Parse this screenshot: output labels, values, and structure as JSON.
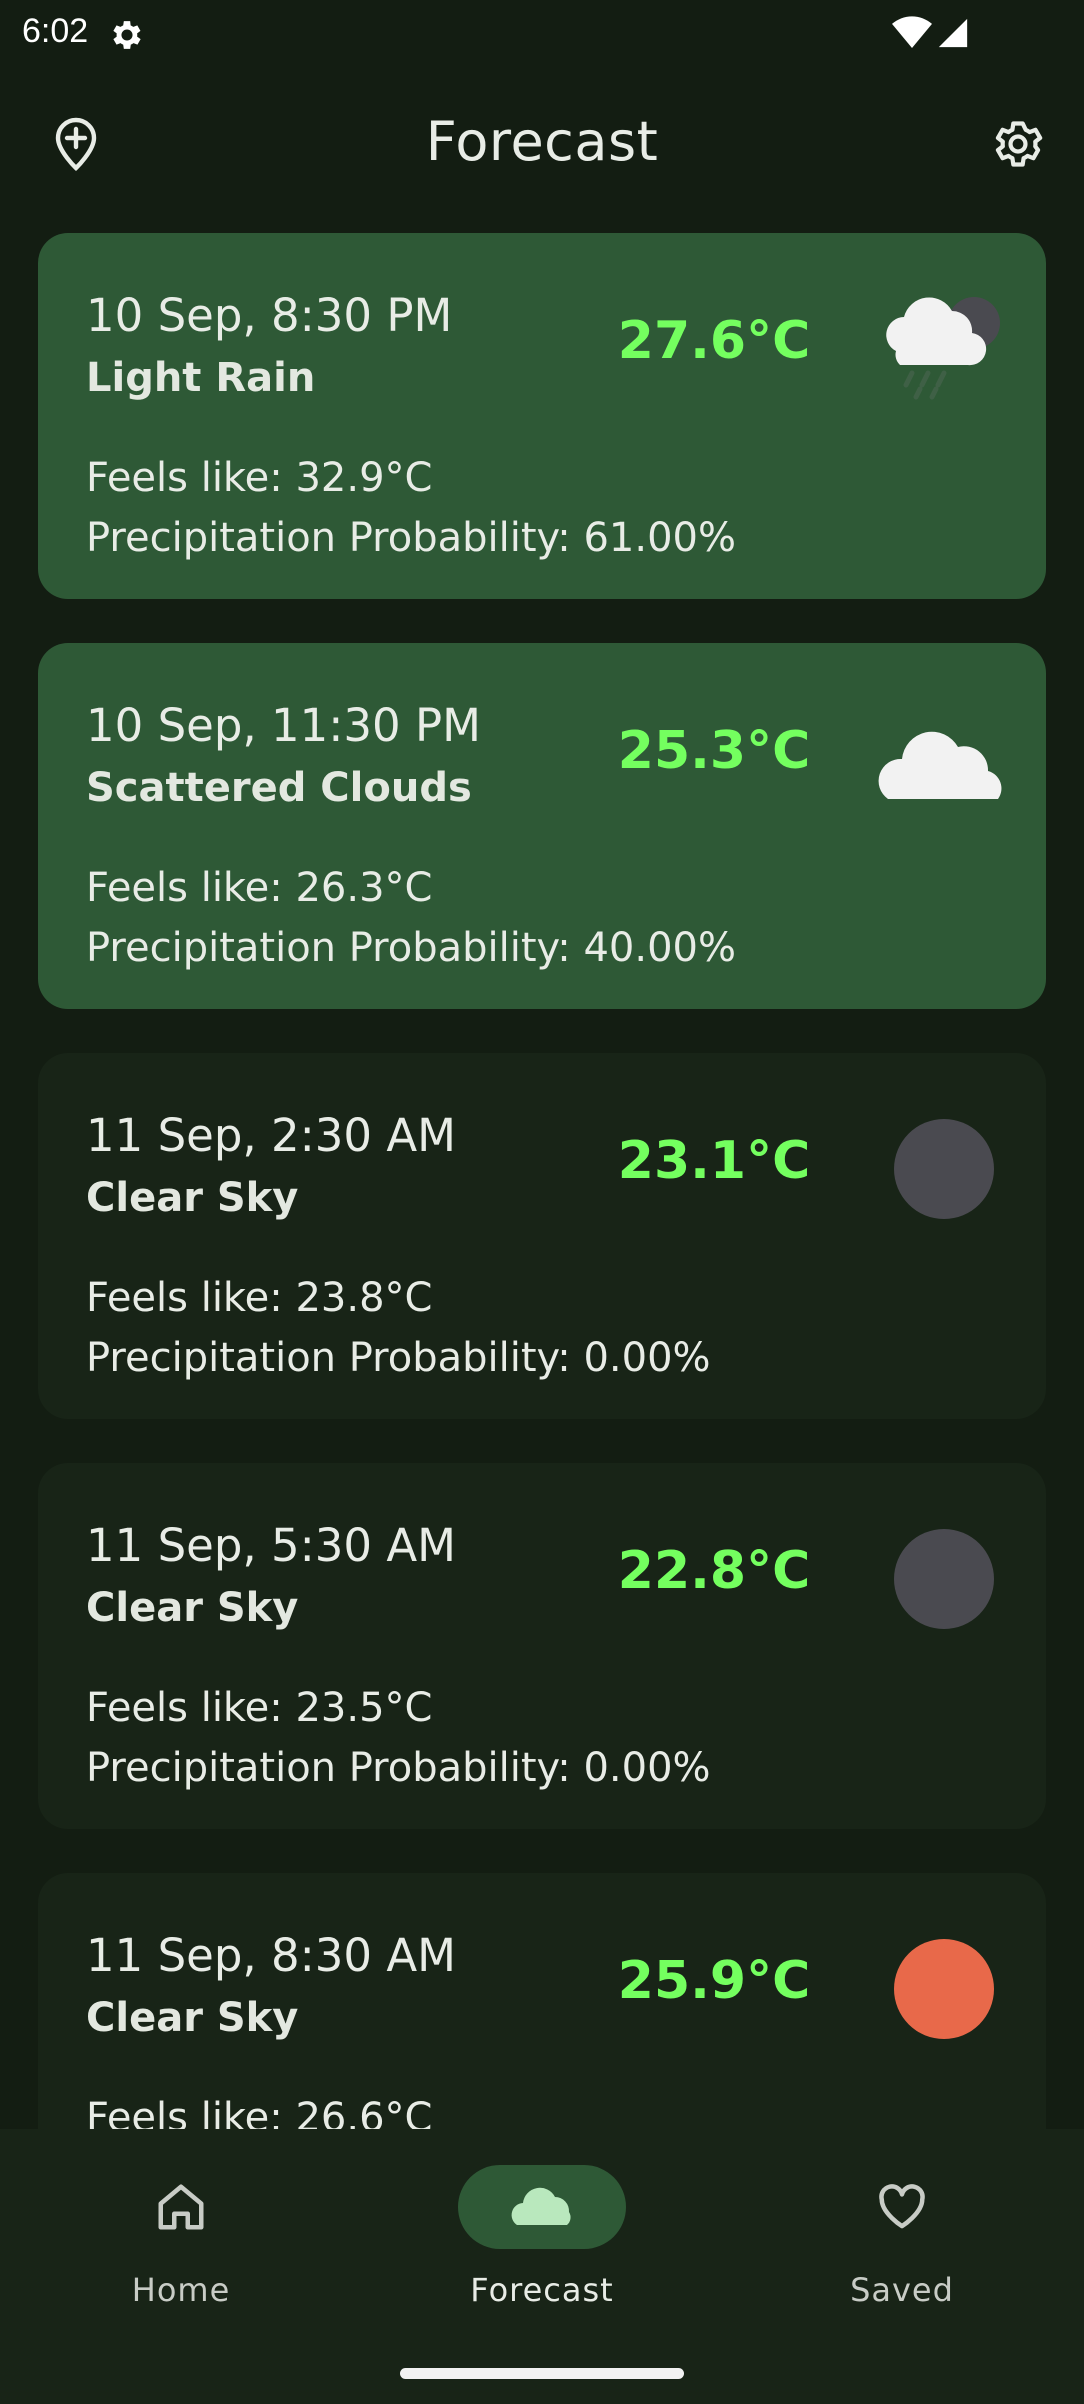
{
  "status_bar": {
    "time": "6:02",
    "icons": [
      "settings-gear-icon",
      "wifi-icon",
      "cell-signal-icon"
    ]
  },
  "header": {
    "title": "Forecast",
    "left_icon": "add-location-icon",
    "right_icon": "settings-icon"
  },
  "colors": {
    "background": "#131d12",
    "card": "#182417",
    "card_highlight": "#2e5936",
    "temperature": "#74ff5f",
    "sun": "#e8694a",
    "moon": "#4a4a50"
  },
  "forecast": [
    {
      "datetime": "10 Sep, 8:30 PM",
      "condition": "Light Rain",
      "temperature": "27.6°C",
      "feels_like": "Feels like: 32.9°C",
      "precipitation": "Precipitation Probability: 61.00%",
      "icon": "night-rain-cloud-icon",
      "highlighted": true
    },
    {
      "datetime": "10 Sep, 11:30 PM",
      "condition": "Scattered Clouds",
      "temperature": "25.3°C",
      "feels_like": "Feels like: 26.3°C",
      "precipitation": "Precipitation Probability: 40.00%",
      "icon": "cloud-icon",
      "highlighted": true
    },
    {
      "datetime": "11 Sep, 2:30 AM",
      "condition": "Clear Sky",
      "temperature": "23.1°C",
      "feels_like": "Feels like: 23.8°C",
      "precipitation": "Precipitation Probability: 0.00%",
      "icon": "moon-icon",
      "highlighted": false
    },
    {
      "datetime": "11 Sep, 5:30 AM",
      "condition": "Clear Sky",
      "temperature": "22.8°C",
      "feels_like": "Feels like: 23.5°C",
      "precipitation": "Precipitation Probability: 0.00%",
      "icon": "moon-icon",
      "highlighted": false
    },
    {
      "datetime": "11 Sep, 8:30 AM",
      "condition": "Clear Sky",
      "temperature": "25.9°C",
      "feels_like": "Feels like: 26.6°C",
      "precipitation": "",
      "icon": "sun-icon",
      "highlighted": false
    }
  ],
  "bottom_nav": {
    "items": [
      {
        "label": "Home",
        "icon": "home-icon",
        "selected": false
      },
      {
        "label": "Forecast",
        "icon": "cloud-icon",
        "selected": true
      },
      {
        "label": "Saved",
        "icon": "heart-icon",
        "selected": false
      }
    ]
  }
}
